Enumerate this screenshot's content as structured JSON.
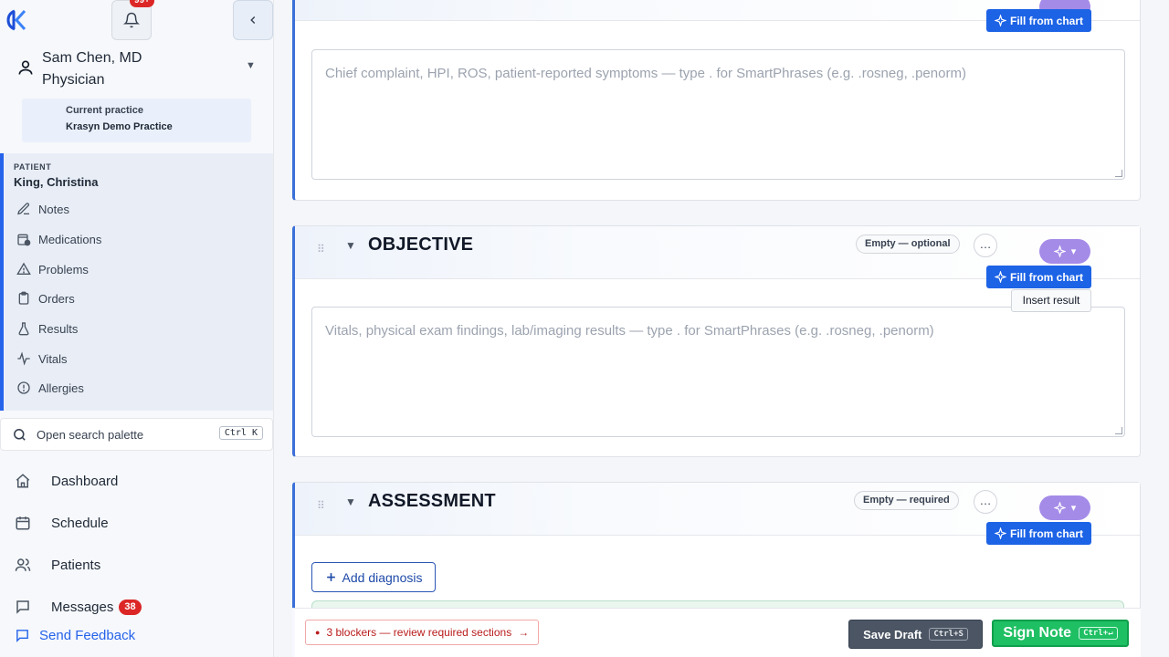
{
  "app": {
    "logo_icon": "krasyn-logo-icon",
    "notifications_badge": "99+",
    "accent_color": "#2563eb",
    "danger_color": "#dc2626",
    "success_color": "#1fbf63"
  },
  "user": {
    "name": "Sam Chen, MD",
    "role": "Physician"
  },
  "practice": {
    "label": "Current practice",
    "name": "Krasyn Demo Practice"
  },
  "patient": {
    "label": "PATIENT",
    "name": "King, Christina",
    "nav": [
      {
        "label": "Notes",
        "icon": "edit-icon"
      },
      {
        "label": "Medications",
        "icon": "medications-icon"
      },
      {
        "label": "Problems",
        "icon": "warning-icon"
      },
      {
        "label": "Orders",
        "icon": "clipboard-icon"
      },
      {
        "label": "Results",
        "icon": "flask-icon"
      },
      {
        "label": "Vitals",
        "icon": "pulse-icon"
      },
      {
        "label": "Allergies",
        "icon": "alert-circle-icon"
      }
    ]
  },
  "search": {
    "label": "Open search palette",
    "shortcut": "Ctrl K"
  },
  "nav": {
    "dashboard": "Dashboard",
    "schedule": "Schedule",
    "patients": "Patients",
    "messages": "Messages",
    "messages_badge": "38",
    "feedback": "Send Feedback"
  },
  "sections": {
    "subjective": {
      "fill_label": "Fill from chart",
      "placeholder": "Chief complaint, HPI, ROS, patient-reported symptoms — type . for SmartPhrases (e.g. .rosneg, .penorm)"
    },
    "objective": {
      "title": "OBJECTIVE",
      "status": "Empty — optional",
      "more": "…",
      "fill_label": "Fill from chart",
      "tooltip": "Insert result",
      "placeholder": "Vitals, physical exam findings, lab/imaging results — type . for SmartPhrases (e.g. .rosneg, .penorm)"
    },
    "assessment": {
      "title": "ASSESSMENT",
      "status": "Empty — required",
      "more": "…",
      "fill_label": "Fill from chart",
      "add_diagnosis": "Add diagnosis"
    }
  },
  "footer": {
    "blockers": "3 blockers — review required sections",
    "save_draft": "Save Draft",
    "save_shortcut": "Ctrl+S",
    "sign_note": "Sign Note",
    "sign_shortcut": "Ctrl+↵"
  }
}
